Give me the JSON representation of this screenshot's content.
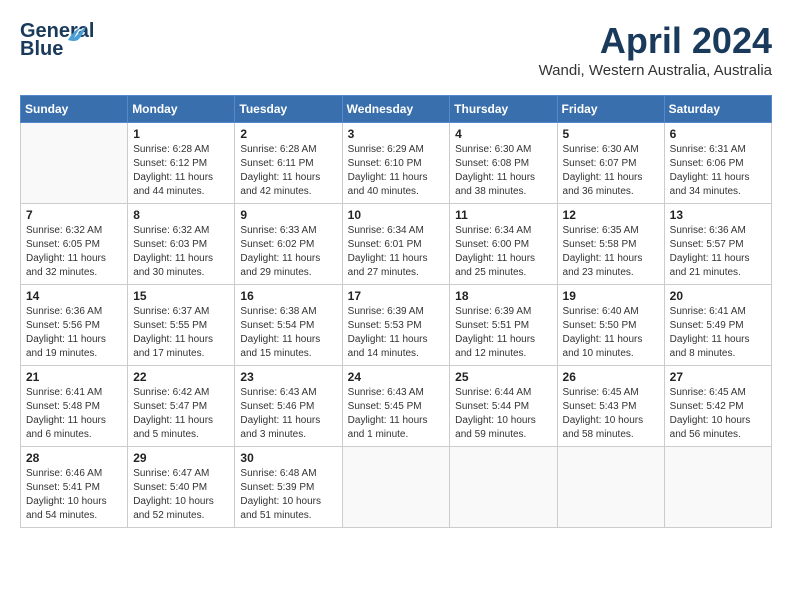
{
  "header": {
    "logo_general": "General",
    "logo_blue": "Blue",
    "month": "April 2024",
    "location": "Wandi, Western Australia, Australia"
  },
  "weekdays": [
    "Sunday",
    "Monday",
    "Tuesday",
    "Wednesday",
    "Thursday",
    "Friday",
    "Saturday"
  ],
  "weeks": [
    [
      {
        "day": "",
        "info": ""
      },
      {
        "day": "1",
        "info": "Sunrise: 6:28 AM\nSunset: 6:12 PM\nDaylight: 11 hours\nand 44 minutes."
      },
      {
        "day": "2",
        "info": "Sunrise: 6:28 AM\nSunset: 6:11 PM\nDaylight: 11 hours\nand 42 minutes."
      },
      {
        "day": "3",
        "info": "Sunrise: 6:29 AM\nSunset: 6:10 PM\nDaylight: 11 hours\nand 40 minutes."
      },
      {
        "day": "4",
        "info": "Sunrise: 6:30 AM\nSunset: 6:08 PM\nDaylight: 11 hours\nand 38 minutes."
      },
      {
        "day": "5",
        "info": "Sunrise: 6:30 AM\nSunset: 6:07 PM\nDaylight: 11 hours\nand 36 minutes."
      },
      {
        "day": "6",
        "info": "Sunrise: 6:31 AM\nSunset: 6:06 PM\nDaylight: 11 hours\nand 34 minutes."
      }
    ],
    [
      {
        "day": "7",
        "info": "Sunrise: 6:32 AM\nSunset: 6:05 PM\nDaylight: 11 hours\nand 32 minutes."
      },
      {
        "day": "8",
        "info": "Sunrise: 6:32 AM\nSunset: 6:03 PM\nDaylight: 11 hours\nand 30 minutes."
      },
      {
        "day": "9",
        "info": "Sunrise: 6:33 AM\nSunset: 6:02 PM\nDaylight: 11 hours\nand 29 minutes."
      },
      {
        "day": "10",
        "info": "Sunrise: 6:34 AM\nSunset: 6:01 PM\nDaylight: 11 hours\nand 27 minutes."
      },
      {
        "day": "11",
        "info": "Sunrise: 6:34 AM\nSunset: 6:00 PM\nDaylight: 11 hours\nand 25 minutes."
      },
      {
        "day": "12",
        "info": "Sunrise: 6:35 AM\nSunset: 5:58 PM\nDaylight: 11 hours\nand 23 minutes."
      },
      {
        "day": "13",
        "info": "Sunrise: 6:36 AM\nSunset: 5:57 PM\nDaylight: 11 hours\nand 21 minutes."
      }
    ],
    [
      {
        "day": "14",
        "info": "Sunrise: 6:36 AM\nSunset: 5:56 PM\nDaylight: 11 hours\nand 19 minutes."
      },
      {
        "day": "15",
        "info": "Sunrise: 6:37 AM\nSunset: 5:55 PM\nDaylight: 11 hours\nand 17 minutes."
      },
      {
        "day": "16",
        "info": "Sunrise: 6:38 AM\nSunset: 5:54 PM\nDaylight: 11 hours\nand 15 minutes."
      },
      {
        "day": "17",
        "info": "Sunrise: 6:39 AM\nSunset: 5:53 PM\nDaylight: 11 hours\nand 14 minutes."
      },
      {
        "day": "18",
        "info": "Sunrise: 6:39 AM\nSunset: 5:51 PM\nDaylight: 11 hours\nand 12 minutes."
      },
      {
        "day": "19",
        "info": "Sunrise: 6:40 AM\nSunset: 5:50 PM\nDaylight: 11 hours\nand 10 minutes."
      },
      {
        "day": "20",
        "info": "Sunrise: 6:41 AM\nSunset: 5:49 PM\nDaylight: 11 hours\nand 8 minutes."
      }
    ],
    [
      {
        "day": "21",
        "info": "Sunrise: 6:41 AM\nSunset: 5:48 PM\nDaylight: 11 hours\nand 6 minutes."
      },
      {
        "day": "22",
        "info": "Sunrise: 6:42 AM\nSunset: 5:47 PM\nDaylight: 11 hours\nand 5 minutes."
      },
      {
        "day": "23",
        "info": "Sunrise: 6:43 AM\nSunset: 5:46 PM\nDaylight: 11 hours\nand 3 minutes."
      },
      {
        "day": "24",
        "info": "Sunrise: 6:43 AM\nSunset: 5:45 PM\nDaylight: 11 hours\nand 1 minute."
      },
      {
        "day": "25",
        "info": "Sunrise: 6:44 AM\nSunset: 5:44 PM\nDaylight: 10 hours\nand 59 minutes."
      },
      {
        "day": "26",
        "info": "Sunrise: 6:45 AM\nSunset: 5:43 PM\nDaylight: 10 hours\nand 58 minutes."
      },
      {
        "day": "27",
        "info": "Sunrise: 6:45 AM\nSunset: 5:42 PM\nDaylight: 10 hours\nand 56 minutes."
      }
    ],
    [
      {
        "day": "28",
        "info": "Sunrise: 6:46 AM\nSunset: 5:41 PM\nDaylight: 10 hours\nand 54 minutes."
      },
      {
        "day": "29",
        "info": "Sunrise: 6:47 AM\nSunset: 5:40 PM\nDaylight: 10 hours\nand 52 minutes."
      },
      {
        "day": "30",
        "info": "Sunrise: 6:48 AM\nSunset: 5:39 PM\nDaylight: 10 hours\nand 51 minutes."
      },
      {
        "day": "",
        "info": ""
      },
      {
        "day": "",
        "info": ""
      },
      {
        "day": "",
        "info": ""
      },
      {
        "day": "",
        "info": ""
      }
    ]
  ]
}
